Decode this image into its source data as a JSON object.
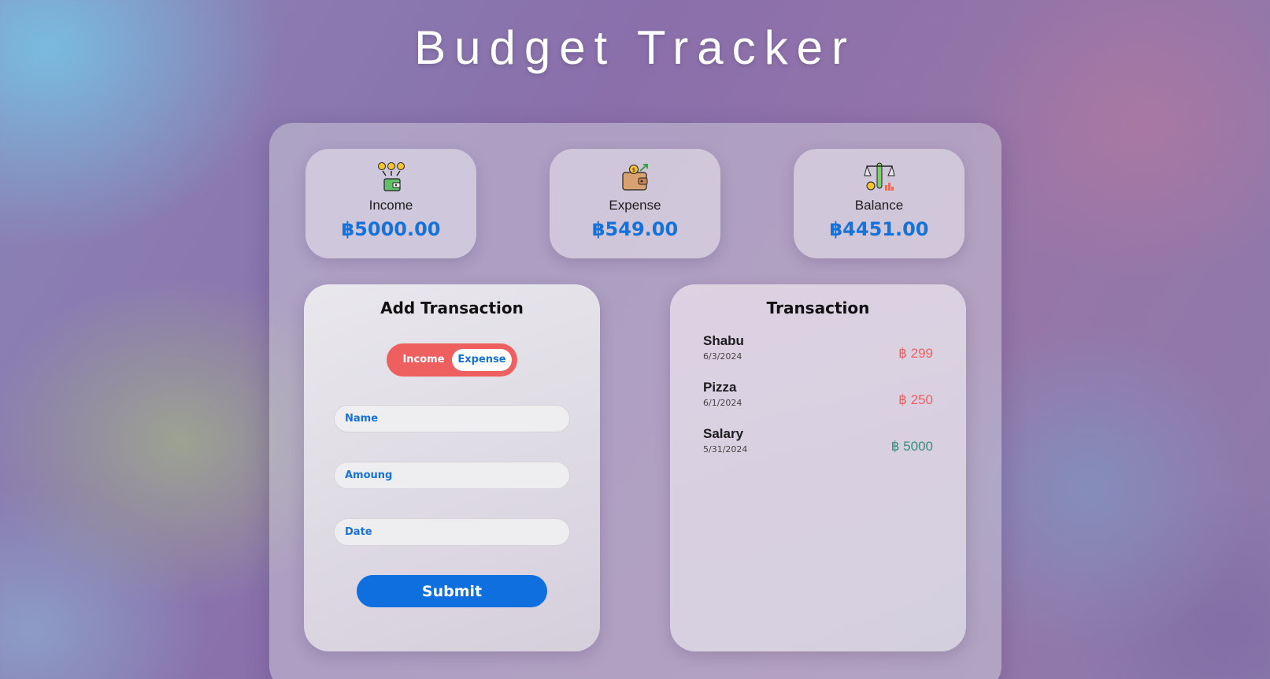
{
  "header": {
    "title": "Budget Tracker"
  },
  "summary": {
    "income": {
      "label": "Income",
      "amount": "฿5000.00",
      "icon": "income-coins-wallet-icon"
    },
    "expense": {
      "label": "Expense",
      "amount": "฿549.00",
      "icon": "wallet-expense-icon"
    },
    "balance": {
      "label": "Balance",
      "amount": "฿4451.00",
      "icon": "balance-scale-icon"
    }
  },
  "add_transaction": {
    "title": "Add Transaction",
    "toggle": {
      "income_label": "Income",
      "expense_label": "Expense",
      "selected": "Expense"
    },
    "fields": {
      "name_placeholder": "Name",
      "amount_placeholder": "Amoung",
      "date_placeholder": "Date"
    },
    "submit_label": "Submit"
  },
  "transactions": {
    "title": "Transaction",
    "items": [
      {
        "name": "Shabu",
        "date": "6/3/2024",
        "amount": "฿ 299",
        "type": "expense"
      },
      {
        "name": "Pizza",
        "date": "6/1/2024",
        "amount": "฿ 250",
        "type": "expense"
      },
      {
        "name": "Salary",
        "date": "5/31/2024",
        "amount": "฿ 5000",
        "type": "income"
      }
    ]
  },
  "colors": {
    "accent_blue": "#1672d8",
    "expense_red": "#ee6060",
    "income_green": "#3b8c7a",
    "submit_blue": "#0f6fde"
  }
}
